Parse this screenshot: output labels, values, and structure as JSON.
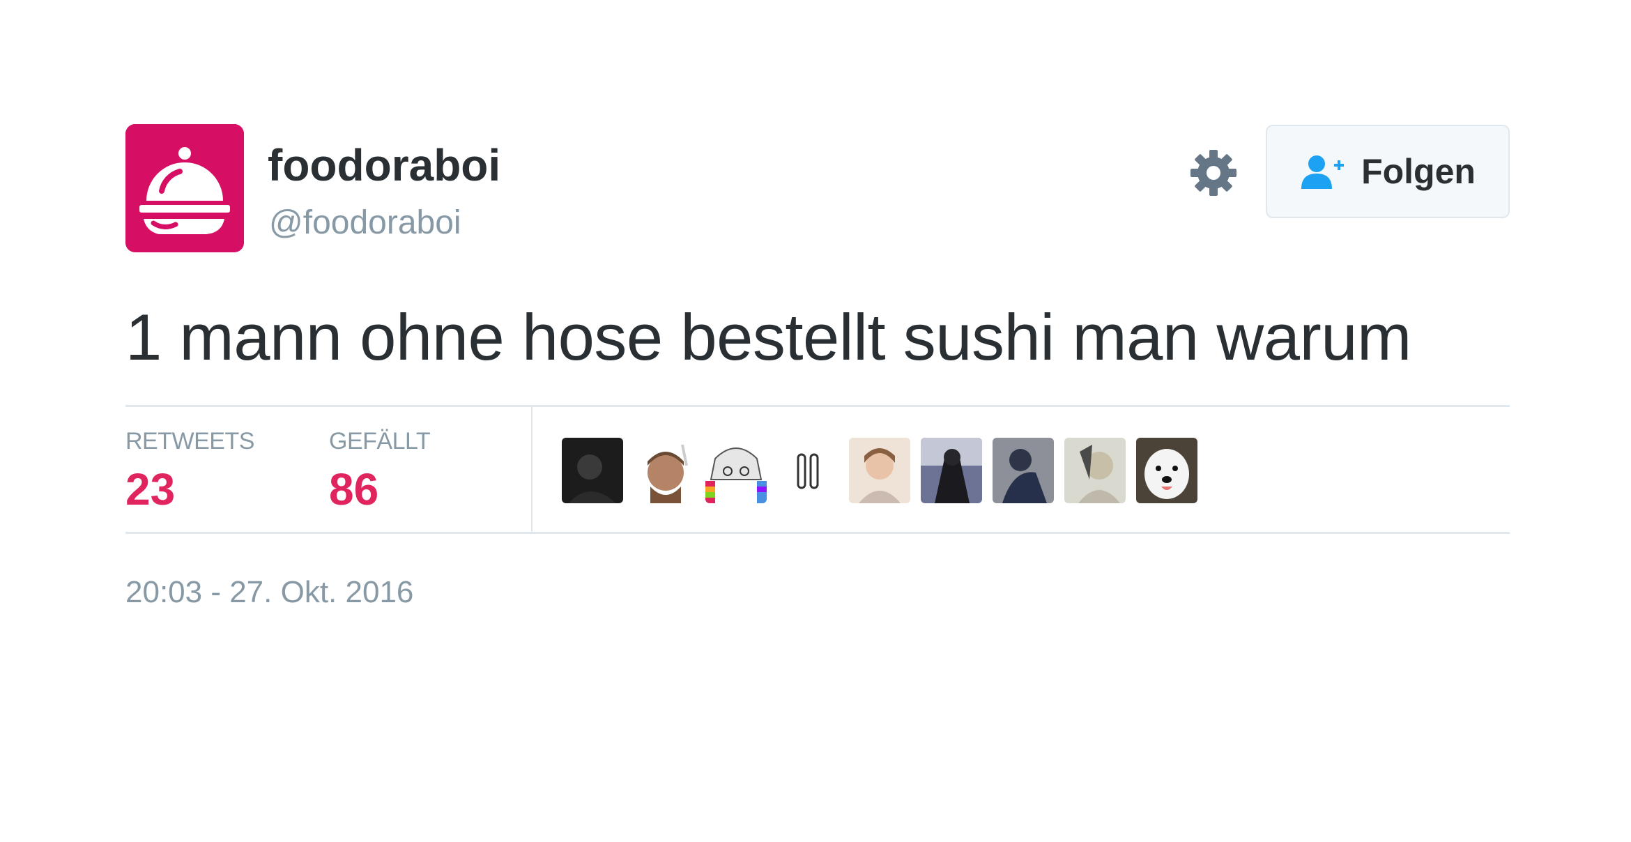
{
  "user": {
    "display_name": "foodoraboi",
    "handle": "@foodoraboi",
    "avatar_icon": "cloche-icon",
    "avatar_color": "#d70f64"
  },
  "actions": {
    "settings_icon": "gear-icon",
    "follow_icon": "add-user-icon",
    "follow_label": "Folgen"
  },
  "tweet": {
    "text": "1 mann ohne hose bestellt sushi man warum",
    "timestamp": "20:03 - 27. Okt. 2016"
  },
  "stats": {
    "retweets_label": "RETWEETS",
    "retweets_value": "23",
    "likes_label": "GEFÄLLT",
    "likes_value": "86",
    "accent_color": "#e0245e"
  },
  "likers": [
    {
      "name": "liker-avatar-1"
    },
    {
      "name": "liker-avatar-2"
    },
    {
      "name": "liker-avatar-3"
    },
    {
      "name": "liker-avatar-4"
    },
    {
      "name": "liker-avatar-5"
    },
    {
      "name": "liker-avatar-6"
    },
    {
      "name": "liker-avatar-7"
    },
    {
      "name": "liker-avatar-8"
    },
    {
      "name": "liker-avatar-9"
    }
  ]
}
